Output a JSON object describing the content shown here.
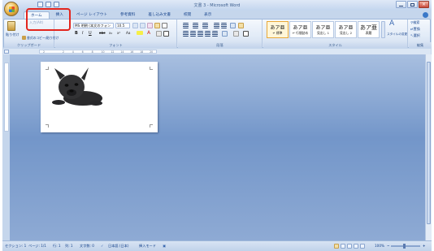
{
  "window": {
    "title": "文書 3 - Microsoft Word",
    "accent": "#c5d6ec",
    "highlight_color": "#e3261e"
  },
  "tabs": [
    {
      "label": "ホーム",
      "active": true
    },
    {
      "label": "挿入",
      "active": false
    },
    {
      "label": "ページ レイアウト",
      "active": false
    },
    {
      "label": "参考資料",
      "active": false
    },
    {
      "label": "差し込み文書",
      "active": false
    },
    {
      "label": "校閲",
      "active": false
    },
    {
      "label": "表示",
      "active": false
    }
  ],
  "tooltip": "入力(Alt)",
  "ribbon": {
    "clipboard": {
      "paste_label": "貼り付け",
      "format_painter_label": "書式のコピー/貼り付け",
      "group_label": "クリップボード"
    },
    "font": {
      "font_name": "MS 明朝 (本文のフォン",
      "font_size": "10.5",
      "bold": "B",
      "italic": "I",
      "underline": "U",
      "strike": "abc",
      "subscript": "x₂",
      "superscript": "x²",
      "change_case": "Aa",
      "font_color": "A",
      "group_label": "フォント"
    },
    "paragraph": {
      "group_label": "段落"
    },
    "styles": {
      "items": [
        {
          "sample": "あア亜",
          "name": "↵ 標準",
          "selected": true
        },
        {
          "sample": "あア亜",
          "name": "↵ 行間詰め",
          "selected": false
        },
        {
          "sample": "あア亜",
          "name": "見出し 1",
          "selected": false
        },
        {
          "sample": "あア亜",
          "name": "見出し 2",
          "selected": false
        },
        {
          "sample": "あア亜",
          "name": "表題",
          "selected": false
        }
      ],
      "change_styles_label": "スタイルの変更",
      "group_label": "スタイル"
    },
    "editing": {
      "find_label": "検索",
      "replace_label": "置換",
      "select_label": "選択",
      "group_label": "編集"
    }
  },
  "ruler": {
    "ticks": [
      "2",
      "",
      "2",
      "4",
      "6",
      "8",
      "10",
      "12",
      "14",
      "16",
      "18",
      "20"
    ]
  },
  "status": {
    "section": "セクション: 1",
    "page": "ページ: 1/1",
    "line": "行: 1",
    "column": "列: 1",
    "word_count": "文字数: 0",
    "language": "日本語 (日本)",
    "insert_mode": "挿入モード",
    "zoom": "100%"
  }
}
